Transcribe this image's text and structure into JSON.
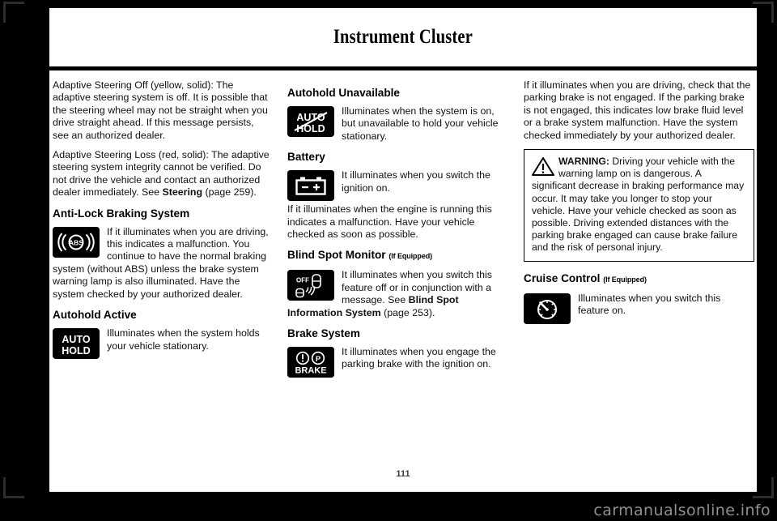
{
  "header": {
    "title": "Instrument Cluster"
  },
  "page_number": "111",
  "watermark": "carmanualsonline.info",
  "columns": {
    "left": {
      "paragraphs": [
        "Adaptive Steering Off (yellow, solid): The adaptive steering system is off. It is possible that the steering wheel may not be straight when you drive straight ahead. If this message persists, see an authorized dealer.",
        "Adaptive Steering Loss (red, solid): The adaptive steering system integrity cannot be verified. Do not drive the vehicle and contact an authorized dealer immediately. See "
      ],
      "xref1_bold": "Steering",
      "xref1_page": " (page 259).",
      "sections": [
        {
          "heading": "Anti-Lock Braking System",
          "icon": "abs-telltale-icon",
          "text": "If it illuminates when you are driving, this indicates a malfunction.  You continue to have the normal braking system (without ABS) unless the brake system warning lamp is also illuminated.  Have the system checked by your authorized dealer."
        },
        {
          "heading": "Autohold Active",
          "icon": "auto-hold-telltale-icon",
          "icon_line1": "AUTO",
          "icon_line2": "HOLD",
          "text": "Illuminates when the system holds your vehicle stationary."
        }
      ]
    },
    "middle": {
      "sections": [
        {
          "heading": "Autohold Unavailable",
          "icon": "auto-hold-unavailable-telltale-icon",
          "icon_line1": "AUTO",
          "icon_line2": "HOLD",
          "text": "Illuminates when the system is on, but unavailable to hold your vehicle stationary."
        },
        {
          "heading": "Battery",
          "icon": "battery-telltale-icon",
          "text": "It illuminates when you switch the ignition on.",
          "text2": "If it illuminates when the engine is running this indicates a malfunction.  Have your vehicle checked as soon as possible."
        },
        {
          "heading": "Blind Spot Monitor",
          "heading_suffix": "(If Equipped)",
          "icon": "blind-spot-off-telltale-icon",
          "icon_label": "OFF",
          "text": "It illuminates when you switch this feature off or in conjunction with a message.  See ",
          "xref_bold": "Blind Spot Information System",
          "xref_page": " (page 253)."
        },
        {
          "heading": "Brake System",
          "icon": "brake-telltale-icon",
          "icon_label": "BRAKE",
          "text": "It illuminates when you engage the parking brake with the ignition on."
        }
      ]
    },
    "right": {
      "intro": "If it illuminates when you are driving, check that the parking brake is not engaged. If the parking brake is not engaged, this indicates low brake fluid level or a brake system malfunction. Have the system checked immediately by your authorized dealer.",
      "warning": {
        "icon": "warning-triangle-icon",
        "label": "WARNING:",
        "text": " Driving your vehicle with the warning lamp on is dangerous. A significant decrease in braking performance may occur. It may take you longer to stop your vehicle. Have your vehicle checked as soon as possible. Driving extended distances with the parking brake engaged can cause brake failure and the risk of personal injury."
      },
      "sections": [
        {
          "heading": "Cruise Control",
          "heading_suffix": "(If Equipped)",
          "icon": "cruise-control-telltale-icon",
          "text": "Illuminates when you switch this feature on."
        }
      ]
    }
  },
  "colors": {
    "page_background": "#ffffff",
    "surround": "#000000",
    "text": "#111111",
    "icon_background": "#000000",
    "icon_foreground": "#ffffff",
    "watermark": "#8f8f8f"
  }
}
